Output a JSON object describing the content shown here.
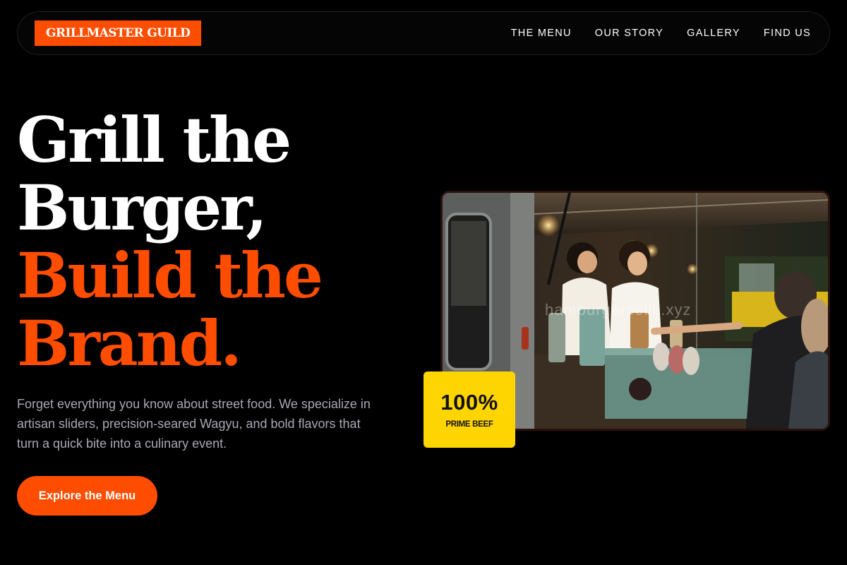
{
  "brand": {
    "name": "GRILLMASTER GUILD",
    "accent": "#ff4d00",
    "badge_color": "#ffd500"
  },
  "nav": {
    "links": [
      {
        "label": "THE MENU"
      },
      {
        "label": "OUR STORY"
      },
      {
        "label": "GALLERY"
      },
      {
        "label": "FIND US"
      }
    ]
  },
  "hero": {
    "headline_lines": [
      "Grill the",
      "Burger,",
      "Build the",
      "Brand."
    ],
    "description": "Forget everything you know about street food. We specialize in artisan sliders, precision-seared Wagyu, and bold flavors that turn a quick bite into a culinary event.",
    "cta_label": "Explore the Menu",
    "image_watermark": "hamburgerselic.xyz",
    "badge": {
      "value": "100%",
      "label": "PRIME BEEF"
    }
  }
}
